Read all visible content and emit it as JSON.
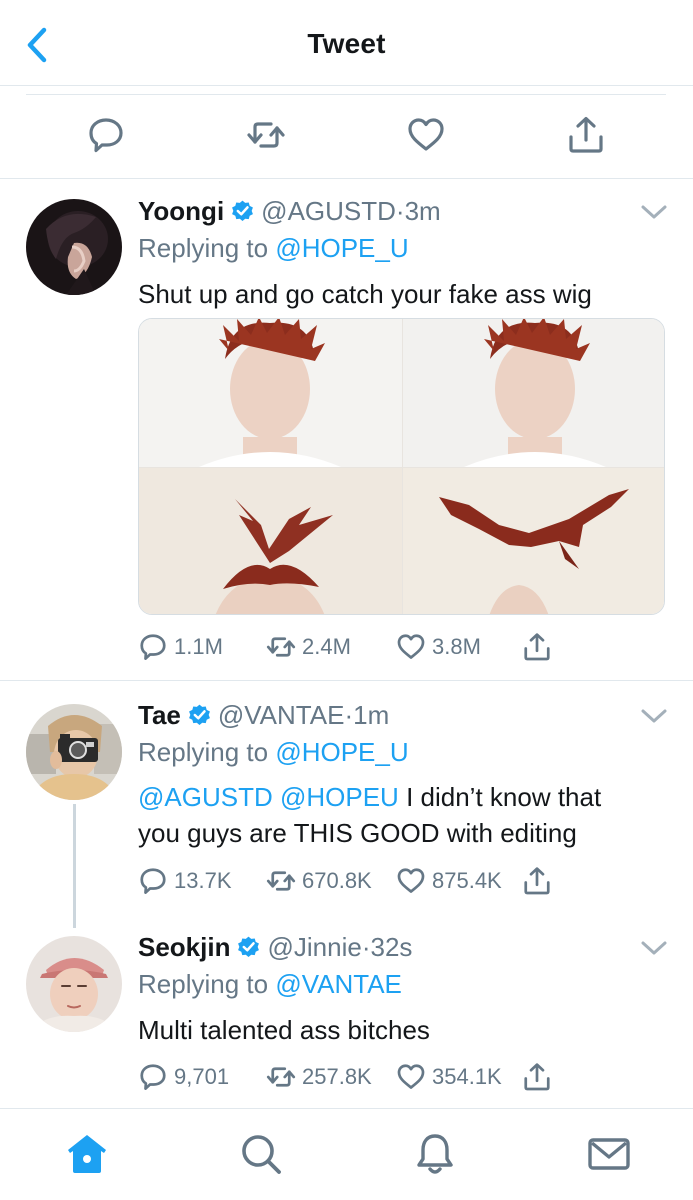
{
  "header": {
    "title": "Tweet"
  },
  "icons": {
    "back": "chevron-left-icon",
    "reply": "speech-bubble-icon",
    "retweet": "retweet-icon",
    "like": "heart-icon",
    "share": "share-icon",
    "verified": "verified-badge-icon",
    "more": "chevron-down-icon"
  },
  "colors": {
    "accent": "#1da1f2",
    "muted": "#657786",
    "text": "#14171a",
    "divider": "#e1e8ed"
  },
  "tweets": [
    {
      "name": "Yoongi",
      "handle": "@AGUSTD",
      "dot": "·",
      "time": "3m",
      "reply_prefix": "Replying to",
      "reply_to": "@HOPE_U",
      "text": "Shut up and go catch your fake ass wig",
      "has_media": true,
      "replies": "1.1M",
      "retweets": "2.4M",
      "likes": "3.8M"
    },
    {
      "name": "Tae",
      "handle": "@VANTAE",
      "dot": "·",
      "time": "1m",
      "reply_prefix": "Replying to",
      "reply_to": "@HOPE_U",
      "mention1": "@AGUSTD",
      "mention2": "@HOPEU",
      "text_rest1": "I didn’t know that",
      "text_line2": "you guys are THIS GOOD with editing",
      "replies": "13.7K",
      "retweets": "670.8K",
      "likes": "875.4K"
    },
    {
      "name": "Seokjin",
      "handle": "@Jinnie",
      "dot": "·",
      "time": "32s",
      "reply_prefix": "Replying to",
      "reply_to": "@VANTAE",
      "text": "Multi talented ass bitches",
      "replies": "9,701",
      "retweets": "257.8K",
      "likes": "354.1K"
    }
  ],
  "tabbar": {
    "items": [
      {
        "icon": "home-icon",
        "active": true
      },
      {
        "icon": "search-icon",
        "active": false
      },
      {
        "icon": "bell-icon",
        "active": false
      },
      {
        "icon": "mail-icon",
        "active": false
      }
    ]
  }
}
